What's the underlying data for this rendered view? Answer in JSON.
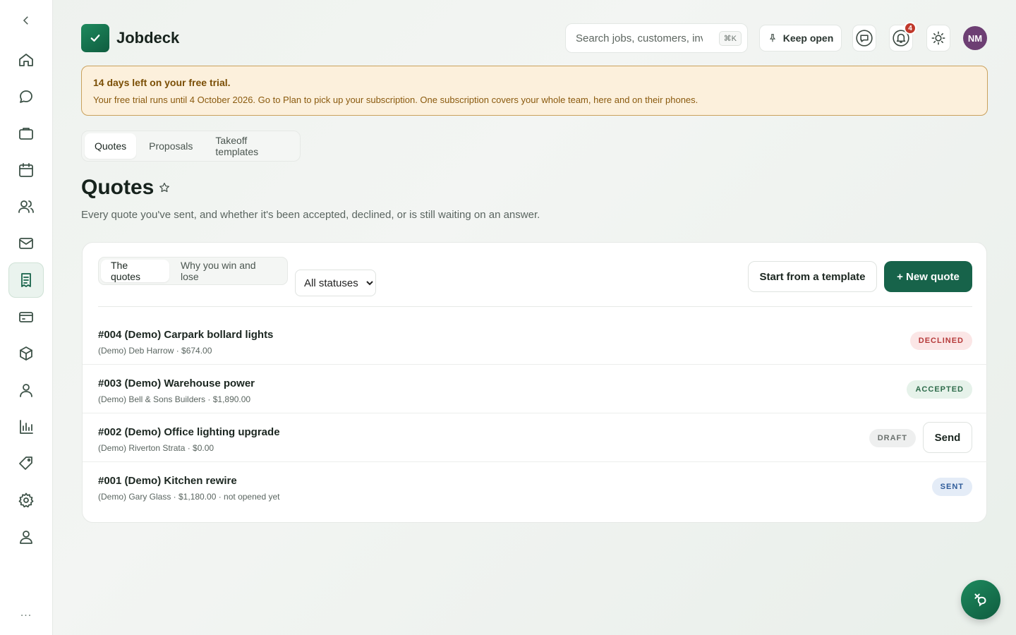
{
  "app": {
    "name": "Jobdeck"
  },
  "sidebar": {
    "items": [
      {
        "icon": "home-icon"
      },
      {
        "icon": "chat-icon"
      },
      {
        "icon": "briefcase-icon"
      },
      {
        "icon": "calendar-icon"
      },
      {
        "icon": "users-icon"
      },
      {
        "icon": "mail-icon"
      },
      {
        "icon": "receipt-icon",
        "active": true
      },
      {
        "icon": "card-icon"
      },
      {
        "icon": "box-icon"
      },
      {
        "icon": "person-icon"
      },
      {
        "icon": "bar-chart-icon"
      },
      {
        "icon": "tag-icon"
      },
      {
        "icon": "gear-icon"
      },
      {
        "icon": "account-icon"
      }
    ],
    "more_label": "..."
  },
  "header": {
    "search_placeholder": "Search jobs, customers, invoices",
    "search_shortcut": "⌘K",
    "keep_open_label": "Keep open",
    "notification_count": "4",
    "avatar_initials": "NM"
  },
  "trial": {
    "title": "14 days left on your free trial.",
    "body": "Your free trial runs until 4 October 2026. Go to Plan to pick up your subscription. One subscription covers your whole team, here and on their phones."
  },
  "tabs": [
    "Quotes",
    "Proposals",
    "Takeoff templates"
  ],
  "page": {
    "title": "Quotes",
    "description": "Every quote you've sent, and whether it's been accepted, declined, or is still waiting on an answer."
  },
  "card": {
    "segments": [
      "The quotes",
      "Why you win and lose"
    ],
    "status_filter": "All statuses",
    "template_button": "Start from a template",
    "new_button": "+ New quote"
  },
  "quotes": [
    {
      "title": "#004 (Demo) Carpark bollard lights",
      "sub": "(Demo) Deb Harrow · $674.00",
      "status": "DECLINED"
    },
    {
      "title": "#003 (Demo) Warehouse power",
      "sub": "(Demo) Bell & Sons Builders · $1,890.00",
      "status": "ACCEPTED"
    },
    {
      "title": "#002 (Demo) Office lighting upgrade",
      "sub": "(Demo) Riverton Strata · $0.00",
      "status": "DRAFT",
      "action": "Send"
    },
    {
      "title": "#001 (Demo) Kitchen rewire",
      "sub": "(Demo) Gary Glass · $1,180.00 · not opened yet",
      "status": "SENT"
    }
  ],
  "colors": {
    "brand": "#17634a",
    "declined": "#b53a3a",
    "accepted": "#2d6b4a",
    "sent": "#2f5c9a",
    "trial_bg": "#fcf0dc"
  }
}
